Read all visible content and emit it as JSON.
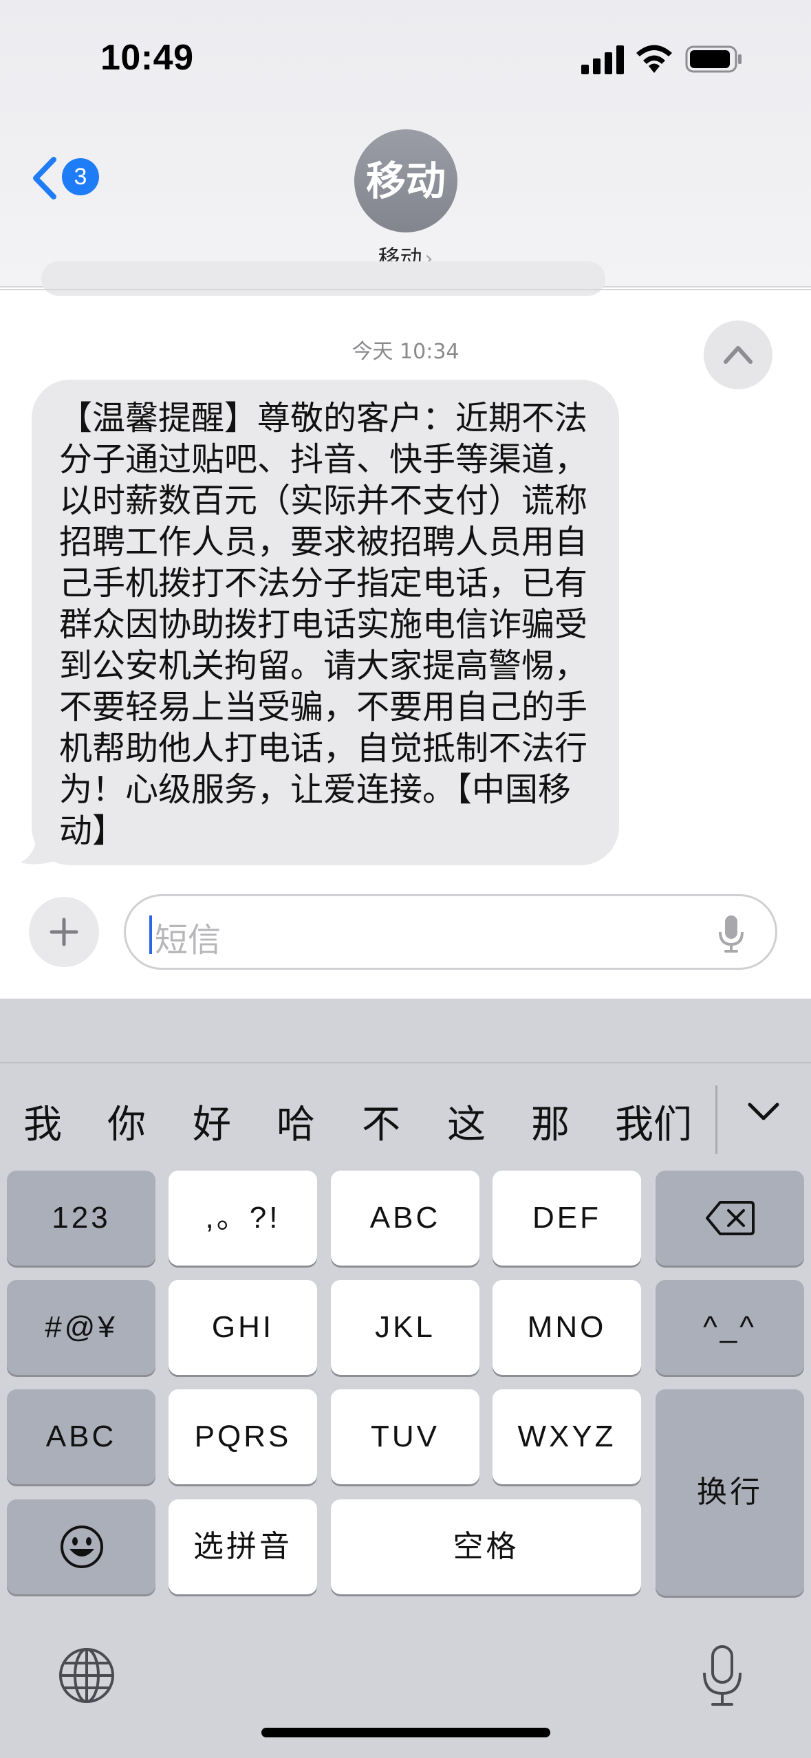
{
  "status_bar": {
    "time": "10:49"
  },
  "header": {
    "back_badge": "3",
    "avatar_text": "移动",
    "contact_name": "移动",
    "contact_chevron": "›"
  },
  "conversation": {
    "timestamp": "今天 10:34",
    "message": "【温馨提醒】尊敬的客户：近期不法分子通过贴吧、抖音、快手等渠道，以时薪数百元（实际并不支付）谎称招聘工作人员，要求被招聘人员用自己手机拨打不法分子指定电话，已有群众因协助拨打电话实施电信诈骗受到公安机关拘留。请大家提高警惕，不要轻易上当受骗，不要用自己的手机帮助他人打电话，自觉抵制不法行为！心级服务，让爱连接。【中国移动】"
  },
  "compose": {
    "placeholder": "短信"
  },
  "keyboard": {
    "suggestions": [
      "我",
      "你",
      "好",
      "哈",
      "不",
      "这",
      "那",
      "我们"
    ],
    "keys": {
      "num": "123",
      "punct": ",。?!",
      "abc": "ABC",
      "def": "DEF",
      "symbols": "#@¥",
      "ghi": "GHI",
      "jkl": "JKL",
      "mno": "MNO",
      "emoticon": "^_^",
      "abc_switch": "ABC",
      "pqrs": "PQRS",
      "tuv": "TUV",
      "wxyz": "WXYZ",
      "return": "换行",
      "pinyin": "选拼音",
      "space": "空格"
    }
  },
  "icons": {
    "back": "chevron-left-icon",
    "scroll_up": "chevron-up-icon",
    "add": "plus-icon",
    "dictation": "microphone-icon",
    "delete": "delete-backward-icon",
    "emoji": "emoji-icon",
    "globe": "globe-icon",
    "collapse": "chevron-down-icon"
  },
  "colors": {
    "accent": "#1f7cf7",
    "bubble": "#e9e9eb",
    "keyboard_bg": "#d1d3d9"
  }
}
